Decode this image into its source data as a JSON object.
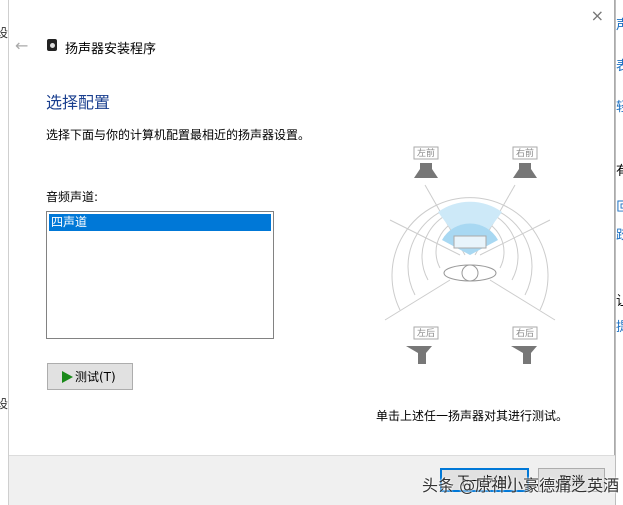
{
  "background": {
    "left_fragments": [
      "设",
      "设"
    ],
    "right_fragments": [
      "声",
      "表",
      "轻",
      "有",
      "叵",
      "跤",
      "让",
      "提"
    ]
  },
  "dialog": {
    "title": "扬声器安装程序",
    "heading": "选择配置",
    "description": "选择下面与你的计算机配置最相近的扬声器设置。",
    "channel_label": "音频声道:",
    "channels": [
      "四声道"
    ],
    "selected_channel": "四声道",
    "test_button": "测试(T)",
    "speakers": {
      "front_left": "左前",
      "front_right": "右前",
      "rear_left": "左后",
      "rear_right": "右后"
    },
    "hint": "单击上述任一扬声器对其进行测试。",
    "next_button": "下一步(N)",
    "cancel_button": "取消",
    "close_icon": "×",
    "back_icon": "←"
  },
  "watermark": "头条 @原神小豪德痛之英酒",
  "colors": {
    "accent": "#0078d7",
    "heading": "#1a3f8f",
    "link": "#1a6fc2"
  }
}
